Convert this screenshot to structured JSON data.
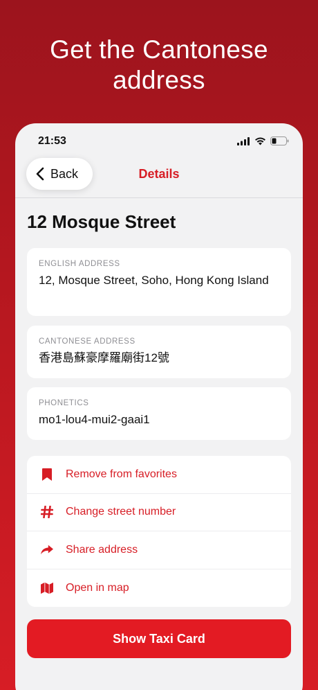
{
  "headline": {
    "line1": "Get the Cantonese",
    "line2": "address"
  },
  "status_bar": {
    "time": "21:53"
  },
  "nav": {
    "back_label": "Back",
    "title": "Details"
  },
  "page_title": "12 Mosque Street",
  "cards": {
    "english": {
      "label": "ENGLISH ADDRESS",
      "value": "12, Mosque Street, Soho, Hong Kong Island"
    },
    "cantonese": {
      "label": "CANTONESE ADDRESS",
      "value": "香港島蘇豪摩羅廟街12號"
    },
    "phonetics": {
      "label": "PHONETICS",
      "value": "mo1-lou4-mui2-gaai1"
    }
  },
  "actions": [
    {
      "label": "Remove from favorites",
      "icon": "bookmark-icon"
    },
    {
      "label": "Change street number",
      "icon": "hash-icon"
    },
    {
      "label": "Share address",
      "icon": "share-arrow-icon"
    },
    {
      "label": "Open in map",
      "icon": "map-icon"
    }
  ],
  "primary_button": {
    "label": "Show Taxi Card"
  },
  "colors": {
    "accent": "#d71d25",
    "background_top": "#9c141d",
    "background_bottom": "#d71d25"
  }
}
